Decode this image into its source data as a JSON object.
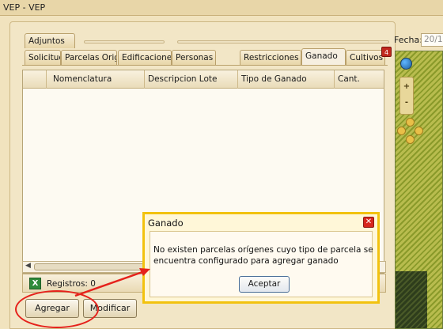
{
  "window": {
    "title": "VEP - VEP"
  },
  "adjuntos_tab": {
    "label": "Adjuntos"
  },
  "tabs": [
    {
      "label": "Solicitud"
    },
    {
      "label": "Parcelas Orig."
    },
    {
      "label": "Edificaciones"
    },
    {
      "label": "Personas"
    },
    {
      "label": "Restricciones"
    },
    {
      "label": "Ganado"
    },
    {
      "label": "Cultivos"
    }
  ],
  "active_tab": "Ganado",
  "tab_badge": {
    "text": "4",
    "color": "#c0281e"
  },
  "grid": {
    "columns": [
      "",
      "Nomenclatura",
      "Descripcion Lote",
      "Tipo de Ganado",
      "Cant."
    ]
  },
  "status_bar": {
    "records_text": "Registros: 0",
    "icon": "excel-icon"
  },
  "actions": {
    "add_label": "Agregar",
    "edit_label": "Modificar"
  },
  "fecha": {
    "label": "Fecha:",
    "value": "20/1"
  },
  "map": {
    "zoom_in": "+",
    "zoom_out": "-",
    "icons": [
      "globe-icon",
      "pan-control"
    ]
  },
  "dialog": {
    "title": "Ganado",
    "message": "No existen parcelas orígenes cuyo tipo de parcela se encuentra configurado para agregar ganado",
    "ok_label": "Aceptar",
    "close_icon": "close-icon",
    "accent_color": "#f2c20f"
  },
  "annotation": {
    "color": "#e5211b"
  }
}
